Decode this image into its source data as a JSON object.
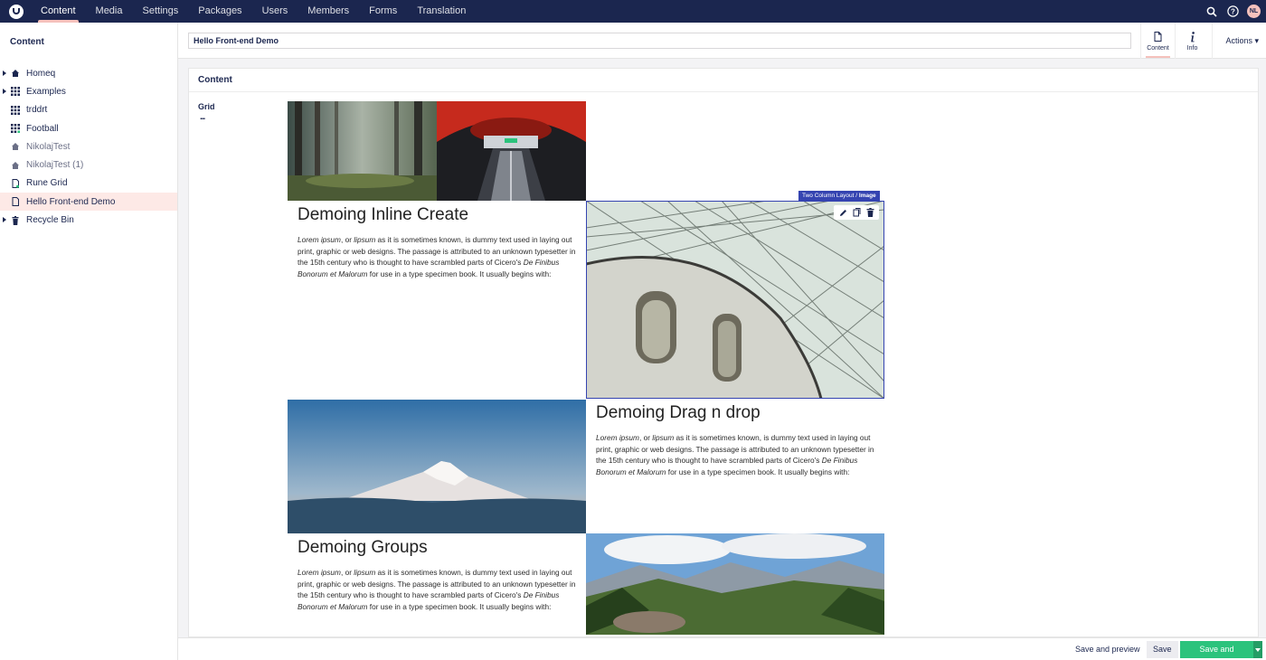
{
  "nav": {
    "items": [
      "Content",
      "Media",
      "Settings",
      "Packages",
      "Users",
      "Members",
      "Forms",
      "Translation"
    ],
    "active": "Content",
    "user_initials": "NL",
    "icons": [
      "search-icon",
      "help-icon"
    ]
  },
  "sidebar": {
    "title": "Content",
    "items": [
      {
        "label": "Homeq",
        "icon": "home-icon"
      },
      {
        "label": "Examples",
        "icon": "grid-icon"
      },
      {
        "label": "trddrt",
        "icon": "grid-icon"
      },
      {
        "label": "Football",
        "icon": "grid-icon"
      },
      {
        "label": "NikolajTest",
        "icon": "home-icon"
      },
      {
        "label": "NikolajTest (1)",
        "icon": "home-icon"
      },
      {
        "label": "Rune Grid",
        "icon": "document-icon"
      },
      {
        "label": "Hello Front-end Demo",
        "icon": "document-icon"
      },
      {
        "label": "Recycle Bin",
        "icon": "trash-icon"
      }
    ]
  },
  "header": {
    "name_value": "Hello Front-end Demo",
    "apps": [
      {
        "label": "Content",
        "icon": "document-icon"
      },
      {
        "label": "Info",
        "icon": "info-icon"
      }
    ],
    "actions_label": "Actions"
  },
  "editor": {
    "group_title": "Content",
    "property_label": "Grid",
    "property_menu": "...",
    "block_label_layout": "Two Column Layout",
    "block_label_sep": "/",
    "block_label_item": "Image",
    "sections": [
      {
        "heading": "Demoing Inline Create"
      },
      {
        "heading": "Demoing Drag n drop"
      },
      {
        "heading": "Demoing Groups"
      }
    ],
    "lorem": {
      "lead": "Lorem ipsum",
      "p1": ", or ",
      "lipsum": "lipsum",
      "p2": " as it is sometimes known, is dummy text used in laying out print, graphic or web designs. The passage is attributed to an unknown typesetter in the 15th century who is thought to have scrambled parts of Cicero's ",
      "book": "De Finibus Bonorum et Malorum",
      "p3": " for use in a type specimen book. It usually begins with:"
    }
  },
  "footer": {
    "preview": "Save and preview",
    "save": "Save",
    "publish": "Save and publish"
  },
  "colors": {
    "nav_bg": "#1b264f",
    "accent_pink": "#f5c1bc",
    "selected_bg": "#fde9e6",
    "block_blue": "#3544b1",
    "publish_green": "#2bc37c"
  }
}
